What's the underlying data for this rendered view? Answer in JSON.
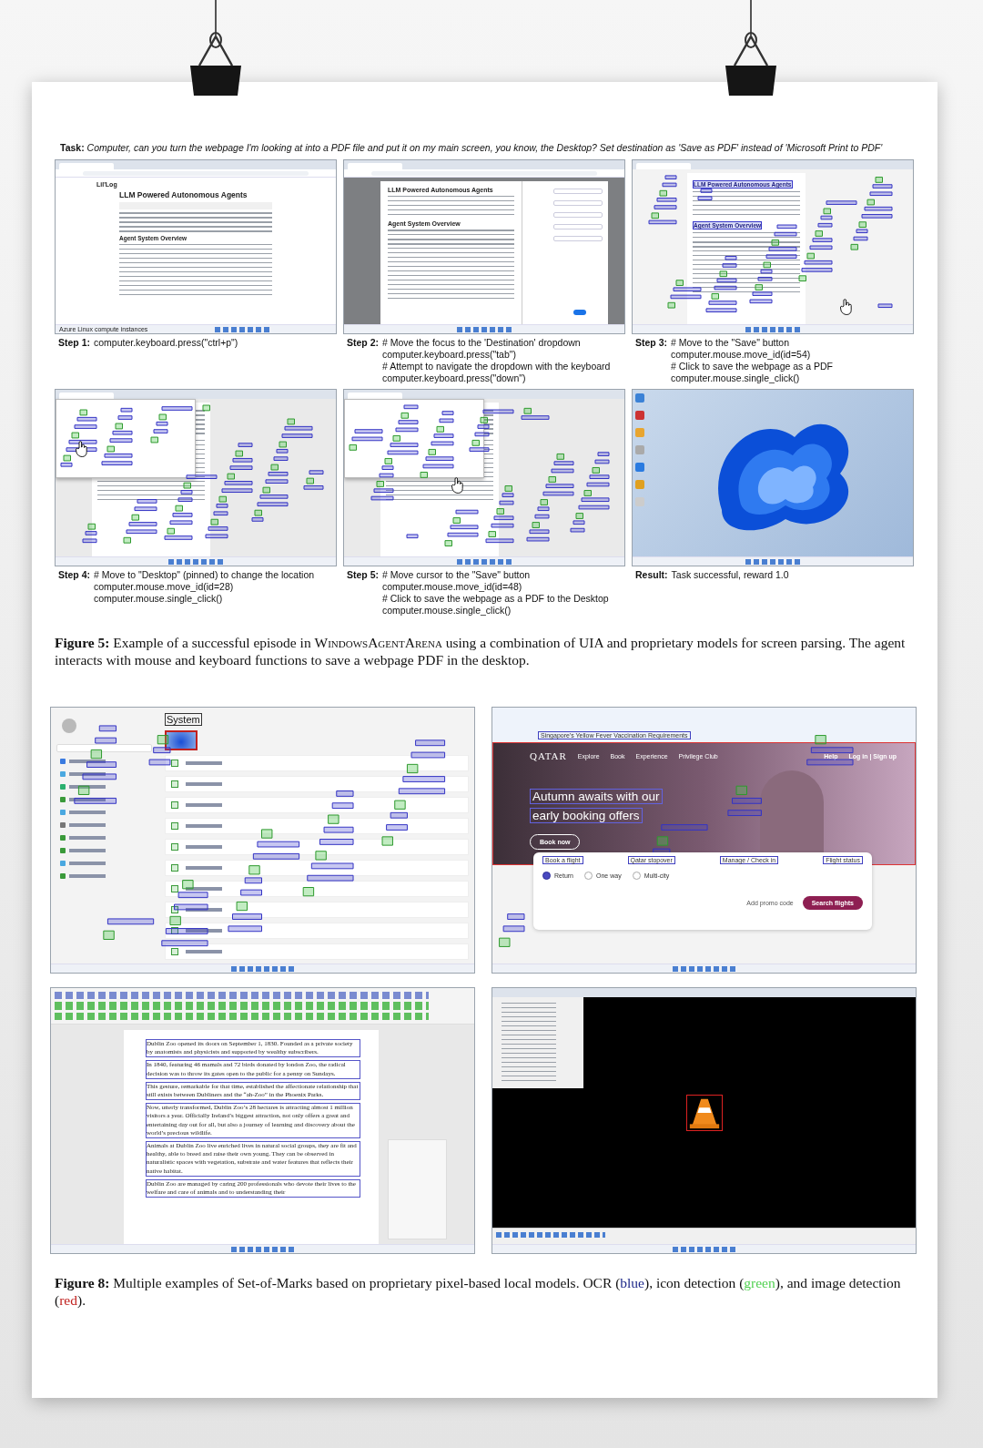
{
  "task": {
    "label": "Task:",
    "text": "Computer, can you turn the webpage I'm looking at into a PDF file and put it on my main screen, you know, the Desktop? Set destination as 'Save as PDF' instead of 'Microsoft Print to PDF'"
  },
  "steps": [
    {
      "label": "Step 1:",
      "lines": [
        "computer.keyboard.press(\"ctrl+p\")"
      ],
      "screen": {
        "kind": "browser",
        "site": "Lil'Log",
        "title": "LLM Powered Autonomous Agents",
        "heading": "Agent System Overview",
        "taskbar_note": "Azure Linux compute instances"
      }
    },
    {
      "label": "Step 2:",
      "lines": [
        "# Move the focus to the 'Destination' dropdown",
        "computer.keyboard.press(\"tab\")",
        "# Attempt to navigate the dropdown with the keyboard",
        "computer.keyboard.press(\"down\")"
      ],
      "screen": {
        "kind": "print-dialog",
        "title": "LLM Powered Autonomous Agents",
        "heading": "Agent System Overview"
      }
    },
    {
      "label": "Step 3:",
      "lines": [
        "# Move to the \"Save\" button",
        "computer.mouse.move_id(id=54)",
        "# Click to save the webpage as a PDF",
        "computer.mouse.single_click()"
      ],
      "screen": {
        "kind": "marked",
        "title": "LLM Powered Autonomous Agents",
        "heading": "Agent System Overview"
      }
    },
    {
      "label": "Step 4:",
      "lines": [
        "# Move to \"Desktop\" (pinned) to change the location",
        "computer.mouse.move_id(id=28)",
        "computer.mouse.single_click()"
      ],
      "screen": {
        "kind": "marked-dialog"
      }
    },
    {
      "label": "Step 5:",
      "lines": [
        "# Move cursor to the \"Save\" button",
        "computer.mouse.move_id(id=48)",
        "# Click to save the webpage as a PDF to the Desktop",
        "computer.mouse.single_click()"
      ],
      "screen": {
        "kind": "marked-dialog"
      }
    },
    {
      "label": "Result:",
      "lines": [
        "Task successful, reward 1.0"
      ],
      "screen": {
        "kind": "desktop"
      }
    }
  ],
  "figure5": {
    "label": "Figure 5:",
    "text_start": "Example of a successful episode in ",
    "small_caps": "WindowsAgentArena",
    "text_end": " using a combination of UIA and proprietary models for screen parsing. The agent interacts with mouse and keyboard functions to save a webpage PDF in the desktop."
  },
  "examples": [
    {
      "kind": "settings",
      "heading": "System"
    },
    {
      "kind": "airline",
      "link": "Singapore's Yellow Fever Vaccination Requirements",
      "logo": "QATAR",
      "nav": [
        "Explore",
        "Book",
        "Experience",
        "Privilege Club"
      ],
      "help": "Help",
      "login": "Log in | Sign up",
      "headline": [
        "Autumn awaits with our",
        "early booking offers"
      ],
      "cta": "Book now",
      "tabs": [
        "Book a flight",
        "Qatar stopover",
        "Manage / Check in",
        "Flight status"
      ],
      "trip_types": [
        {
          "label": "Return",
          "selected": true
        },
        {
          "label": "One way",
          "selected": false
        },
        {
          "label": "Multi-city",
          "selected": false
        }
      ],
      "promo": "Add promo code",
      "search": "Search flights"
    },
    {
      "kind": "writer",
      "paragraphs": [
        "Dublin Zoo opened its doors on September 1, 1830. Founded as a private society by anatomists and physicists and supported by wealthy subscribers.",
        "In 1840, featuring 46 mamals and 72 birds donated by london Zoo, the radical decision was to throw its gates open to the public for a penny on Sundays.",
        "This gesture, remarkable for that time, established the affectionate relationship that still exists between Dubliners and the “ah-Zoo” in the Phoenix Parks.",
        "Now, utterly transformed, Dublin Zoo’s 28 hectares is attracting almost 1 million visitors a year. Officially Ireland’s biggest attraction, not only offers a great and entertaining day out for all, but also a journey of learning and discovery about the world’s precious wildlife.",
        "Animals at Dublin Zoo live enriched lives in natural social groups, they are fit and healthy, able to breed and raise their own young. They can be observed in naturalistic spaces with vegetation, substrate and water features that reflects their native habitat.",
        "Dublin Zoo are managed by caring 200 professionals who devote their lives to the welfare and care of animals and to understanding their"
      ]
    },
    {
      "kind": "media-player"
    }
  ],
  "figure8": {
    "label": "Figure 8:",
    "parts": [
      {
        "text": "Multiple examples of Set-of-Marks based on proprietary pixel-based local models. OCR ("
      },
      {
        "text": "blue",
        "color": "#1f2a8a"
      },
      {
        "text": "), icon detection ("
      },
      {
        "text": "green",
        "color": "#52d152"
      },
      {
        "text": "), and image detection ("
      },
      {
        "text": "red",
        "color": "#c0211f"
      },
      {
        "text": ")."
      }
    ]
  }
}
